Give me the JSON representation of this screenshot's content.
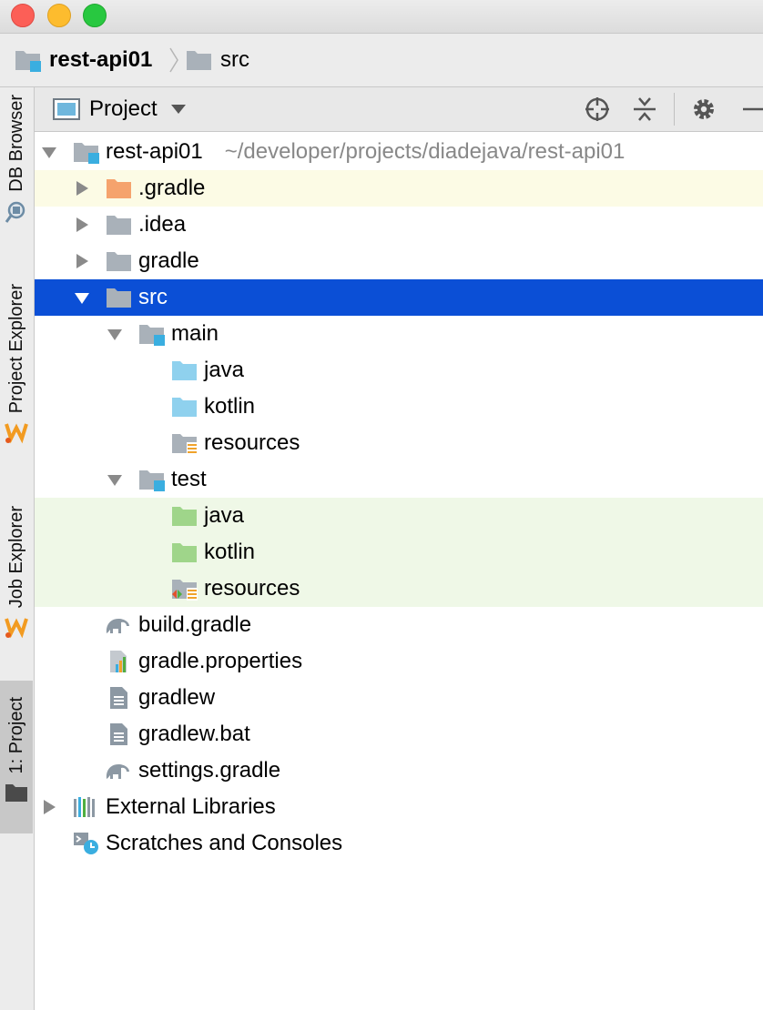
{
  "breadcrumb": {
    "project": "rest-api01",
    "folder": "src"
  },
  "tool_windows": [
    {
      "label": "DB Browser"
    },
    {
      "label": "Project Explorer"
    },
    {
      "label": "Job Explorer"
    },
    {
      "label": "1: Project"
    }
  ],
  "project_pane": {
    "title": "Project",
    "actions": [
      "locate-icon",
      "collapse-all-icon",
      "gear-icon",
      "hide-icon"
    ]
  },
  "tree": {
    "root": {
      "label": "rest-api01",
      "path": "~/developer/projects/diadejava/rest-api01"
    },
    "items": [
      {
        "label": ".gradle",
        "icon": "folder-orange-icon",
        "state": "collapsed"
      },
      {
        "label": ".idea",
        "icon": "folder-gray-icon",
        "state": "collapsed"
      },
      {
        "label": "gradle",
        "icon": "folder-gray-icon",
        "state": "collapsed"
      },
      {
        "label": "src",
        "icon": "folder-gray-icon",
        "state": "expanded",
        "selected": true
      },
      {
        "label": "main",
        "icon": "module-folder-icon",
        "state": "expanded"
      },
      {
        "label": "java",
        "icon": "source-folder-icon"
      },
      {
        "label": "kotlin",
        "icon": "source-folder-icon"
      },
      {
        "label": "resources",
        "icon": "resources-folder-icon"
      },
      {
        "label": "test",
        "icon": "module-folder-icon",
        "state": "expanded"
      },
      {
        "label": "java",
        "icon": "test-folder-icon"
      },
      {
        "label": "kotlin",
        "icon": "test-folder-icon"
      },
      {
        "label": "resources",
        "icon": "test-resources-folder-icon"
      },
      {
        "label": "build.gradle",
        "icon": "gradle-elephant-icon"
      },
      {
        "label": "gradle.properties",
        "icon": "properties-file-icon"
      },
      {
        "label": "gradlew",
        "icon": "text-file-icon"
      },
      {
        "label": "gradlew.bat",
        "icon": "text-file-icon"
      },
      {
        "label": "settings.gradle",
        "icon": "gradle-elephant-icon"
      },
      {
        "label": "External Libraries",
        "icon": "libraries-icon",
        "state": "collapsed"
      },
      {
        "label": "Scratches and Consoles",
        "icon": "scratches-icon"
      }
    ]
  },
  "colors": {
    "selection": "#0b4fd6",
    "excluded_highlight": "#fcfbe5",
    "test_highlight": "#eff8e7",
    "source_folder": "#8fd1ee",
    "test_folder": "#9fd58a",
    "orange_folder": "#f5a36d",
    "gray_folder": "#a9b1b9",
    "module_badge": "#3aaee0"
  }
}
